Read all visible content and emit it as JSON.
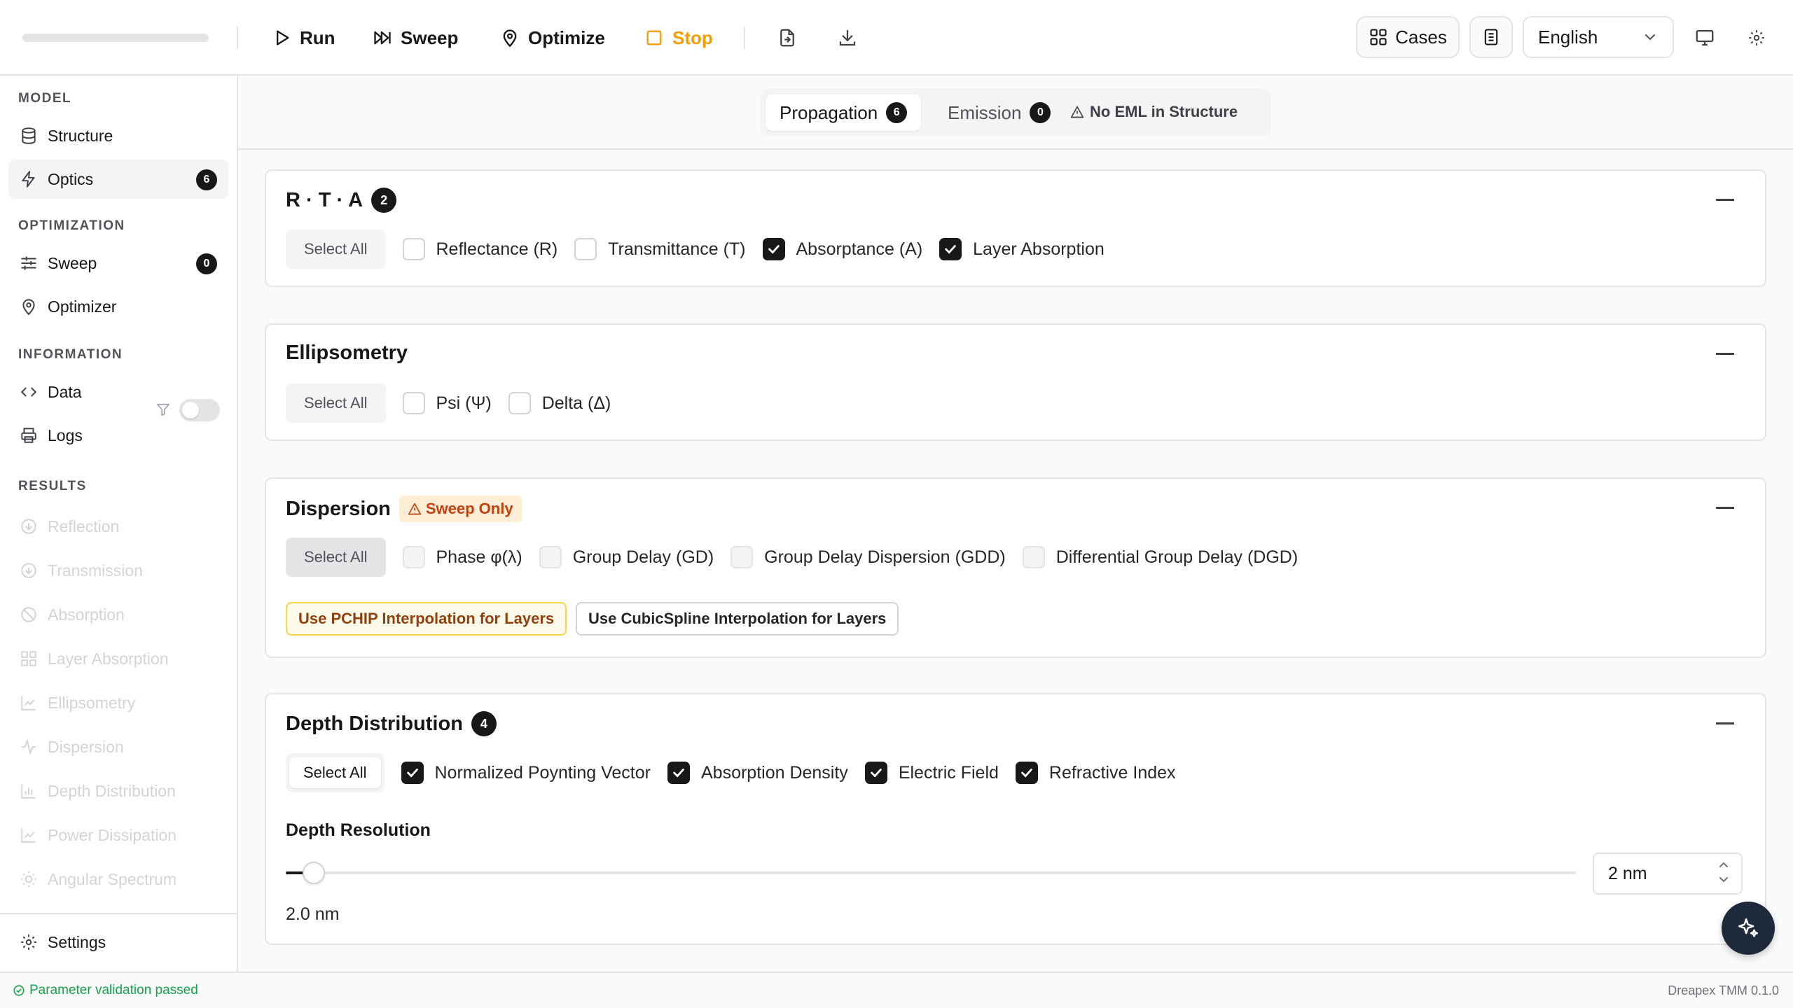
{
  "toolbar": {
    "run_label": "Run",
    "sweep_label": "Sweep",
    "optimize_label": "Optimize",
    "stop_label": "Stop",
    "cases_label": "Cases",
    "language": "English"
  },
  "sidebar": {
    "sections": {
      "model": "MODEL",
      "optimization": "OPTIMIZATION",
      "information": "INFORMATION",
      "results": "RESULTS"
    },
    "model_items": [
      {
        "label": "Structure"
      },
      {
        "label": "Optics",
        "badge": "6"
      }
    ],
    "optimization_items": [
      {
        "label": "Sweep",
        "badge": "0"
      },
      {
        "label": "Optimizer"
      }
    ],
    "information_items": [
      {
        "label": "Data"
      },
      {
        "label": "Logs"
      }
    ],
    "results_items": [
      {
        "label": "Reflection"
      },
      {
        "label": "Transmission"
      },
      {
        "label": "Absorption"
      },
      {
        "label": "Layer Absorption"
      },
      {
        "label": "Ellipsometry"
      },
      {
        "label": "Dispersion"
      },
      {
        "label": "Depth Distribution"
      },
      {
        "label": "Power Dissipation"
      },
      {
        "label": "Angular Spectrum"
      }
    ],
    "results_filter_enabled": false,
    "settings_label": "Settings"
  },
  "tabs": {
    "propagation": {
      "label": "Propagation",
      "badge": "6"
    },
    "emission": {
      "label": "Emission",
      "badge": "0"
    },
    "warning": "No EML in Structure"
  },
  "cards": {
    "rta": {
      "title": "R · T · A",
      "badge": "2",
      "select_all": "Select All",
      "options": [
        {
          "label": "Reflectance (R)",
          "checked": false
        },
        {
          "label": "Transmittance (T)",
          "checked": false
        },
        {
          "label": "Absorptance (A)",
          "checked": true
        },
        {
          "label": "Layer Absorption",
          "checked": true
        }
      ]
    },
    "ellipsometry": {
      "title": "Ellipsometry",
      "select_all": "Select All",
      "options": [
        {
          "label": "Psi (Ψ)",
          "checked": false
        },
        {
          "label": "Delta (Δ)",
          "checked": false
        }
      ]
    },
    "dispersion": {
      "title": "Dispersion",
      "warning": "Sweep Only",
      "select_all": "Select All",
      "options": [
        {
          "label": "Phase φ(λ)",
          "checked": false
        },
        {
          "label": "Group Delay (GD)",
          "checked": false
        },
        {
          "label": "Group Delay Dispersion (GDD)",
          "checked": false
        },
        {
          "label": "Differential Group Delay (DGD)",
          "checked": false
        }
      ],
      "pchip_label": "Use PCHIP Interpolation for Layers",
      "cubic_label": "Use CubicSpline Interpolation for Layers"
    },
    "depth": {
      "title": "Depth Distribution",
      "badge": "4",
      "select_all": "Select All",
      "options": [
        {
          "label": "Normalized Poynting Vector",
          "checked": true
        },
        {
          "label": "Absorption Density",
          "checked": true
        },
        {
          "label": "Electric Field",
          "checked": true
        },
        {
          "label": "Refractive Index",
          "checked": true
        }
      ],
      "resolution_label": "Depth Resolution",
      "resolution_fraction": 0.01,
      "resolution_value": "2.0 nm",
      "input_value": "2 nm"
    }
  },
  "status": {
    "message": "Parameter validation passed",
    "version": "Dreapex TMM 0.1.0"
  },
  "colors": {
    "accent_dark": "#18181b",
    "warning": "#f59e0b",
    "success": "#16a34a"
  }
}
